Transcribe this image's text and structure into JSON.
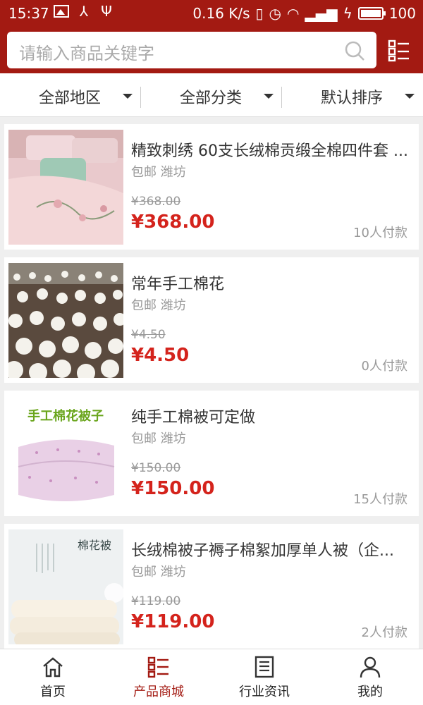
{
  "status_bar": {
    "time": "15:37",
    "network_speed": "0.16 K/s",
    "battery": "100"
  },
  "search": {
    "placeholder": "请输入商品关键字"
  },
  "filters": [
    {
      "label": "全部地区"
    },
    {
      "label": "全部分类"
    },
    {
      "label": "默认排序"
    }
  ],
  "products": [
    {
      "title": "精致刺绣 60支长绒棉贡缎全棉四件套 ...",
      "tag": "包邮 潍坊",
      "old_price": "¥368.00",
      "price": "¥368.00",
      "sold": "10人付款",
      "image": "pink-bedding-photo"
    },
    {
      "title": "常年手工棉花",
      "tag": "包邮 潍坊",
      "old_price": "¥4.50",
      "price": "¥4.50",
      "sold": "0人付款",
      "image": "cotton-field-photo"
    },
    {
      "title": "纯手工棉被可定做",
      "tag": "包邮 潍坊",
      "old_price": "¥150.00",
      "price": "¥150.00",
      "sold": "15人付款",
      "image": "handmade-quilt-photo",
      "image_caption": "手工棉花被子"
    },
    {
      "title": "长绒棉被子褥子棉絮加厚单人被（企...",
      "tag": "包邮 潍坊",
      "old_price": "¥119.00",
      "price": "¥119.00",
      "sold": "2人付款",
      "image": "cotton-quilt-photo",
      "image_caption": "棉花被"
    }
  ],
  "tabbar": [
    {
      "label": "首页",
      "icon": "home-icon"
    },
    {
      "label": "产品商城",
      "icon": "grid-list-icon",
      "active": true
    },
    {
      "label": "行业资讯",
      "icon": "news-icon"
    },
    {
      "label": "我的",
      "icon": "user-icon"
    }
  ],
  "colors": {
    "header": "#a31a12",
    "price": "#d4231c"
  }
}
